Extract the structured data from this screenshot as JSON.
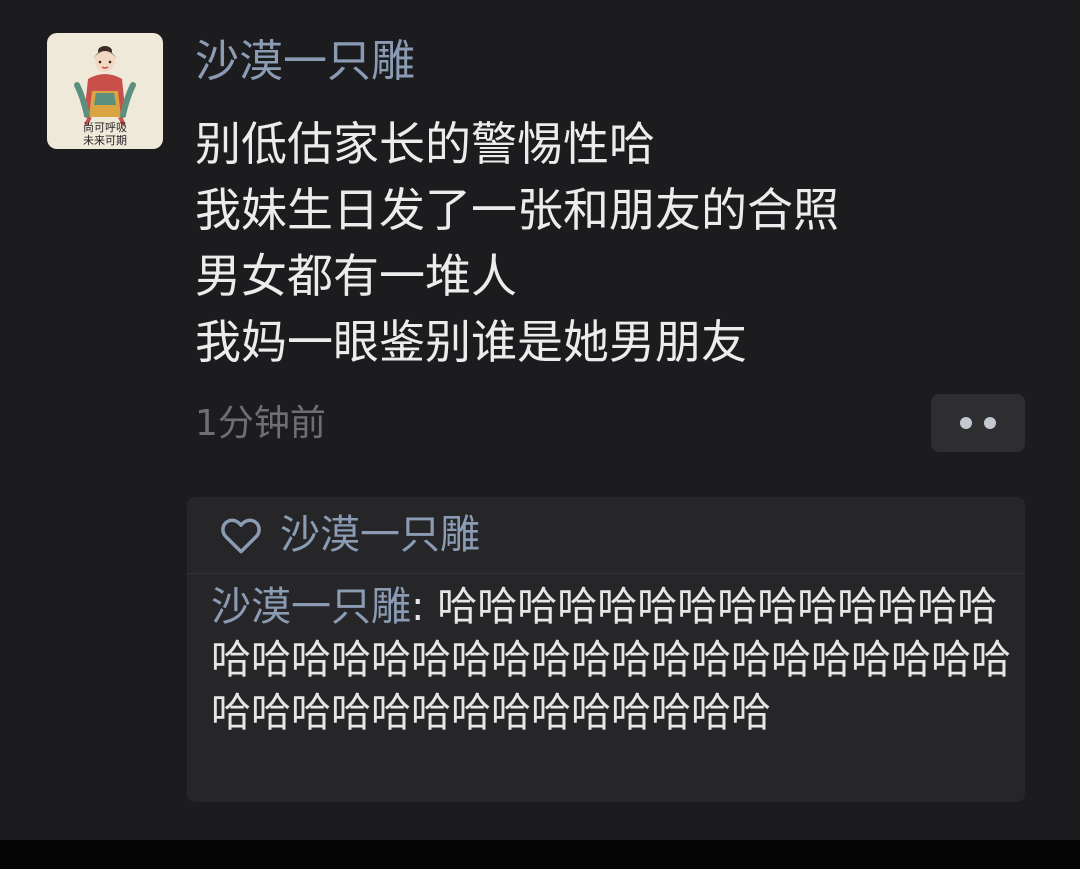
{
  "post": {
    "author": "沙漠一只雕",
    "avatar": {
      "caption_line1": "尚可呼吸",
      "caption_line2": "未来可期"
    },
    "lines": [
      "别低估家长的警惕性哈",
      "我妹生日发了一张和朋友的合照",
      "男女都有一堆人",
      "我妈一眼鉴别谁是她男朋友"
    ],
    "timestamp": "1分钟前"
  },
  "likes": {
    "names": "沙漠一只雕"
  },
  "comments": [
    {
      "author": "沙漠一只雕",
      "separator": ": ",
      "text": "哈哈哈哈哈哈哈哈哈哈哈哈哈哈哈哈哈哈哈哈哈哈哈哈哈哈哈哈哈哈哈哈哈哈哈哈哈哈哈哈哈哈哈哈哈哈哈哈"
    }
  ],
  "colors": {
    "background": "#1c1c1e",
    "name_link": "#8a9bb3",
    "body_text": "#ececec",
    "timestamp": "#6f6f73",
    "panel": "#262628"
  }
}
